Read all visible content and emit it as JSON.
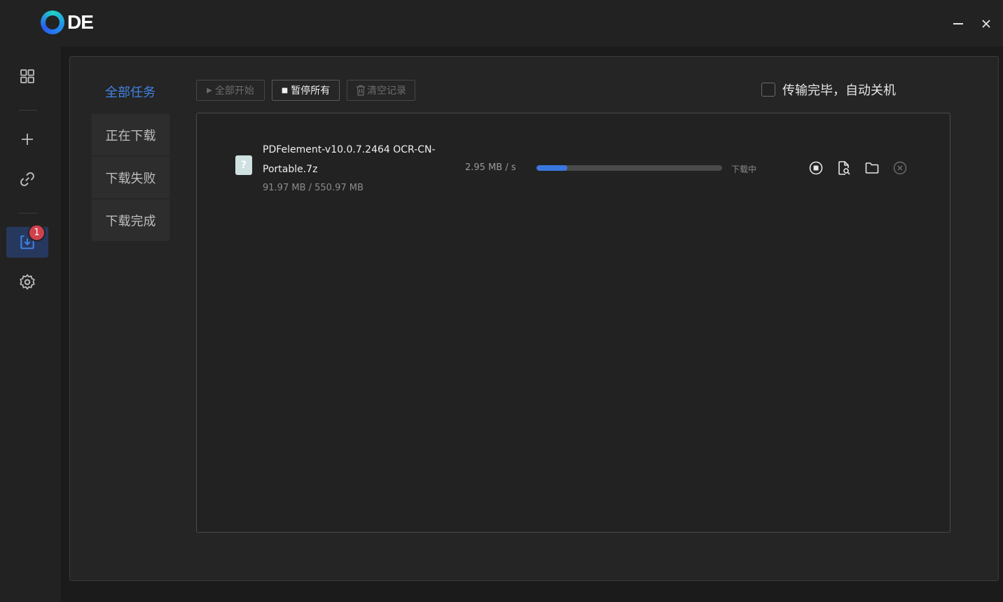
{
  "app": {
    "logo_text": "DE"
  },
  "window_controls": {
    "minimize_icon": "minimize-icon",
    "close_icon": "close-icon"
  },
  "rail": {
    "items": [
      {
        "icon": "grid-icon"
      },
      {
        "icon": "plus-icon"
      },
      {
        "icon": "link-icon"
      },
      {
        "icon": "download-icon",
        "badge": "1",
        "active": true
      },
      {
        "icon": "gear-icon"
      }
    ]
  },
  "categories": {
    "all": "全部任务",
    "items": [
      "正在下载",
      "下载失败",
      "下载完成"
    ]
  },
  "toolbar": {
    "start_all": "全部开始",
    "pause_all": "暂停所有",
    "clear_records": "清空记录",
    "accent": "#3f83e6"
  },
  "auto_shutdown": {
    "label": "传输完毕，自动关机",
    "checked": false
  },
  "tasks": [
    {
      "name": "PDFelement-v10.0.7.2464 OCR-CN-Portable.7z",
      "size": "91.97 MB / 550.97 MB",
      "speed": "2.95 MB / s",
      "progress": 0.167,
      "status": "下载中"
    }
  ]
}
